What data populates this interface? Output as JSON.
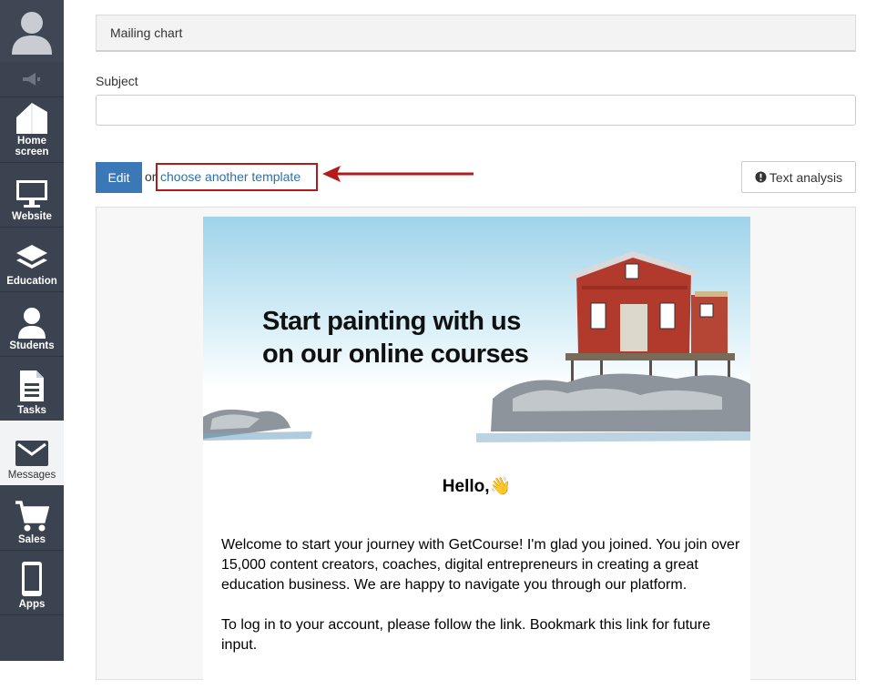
{
  "sidebar": {
    "items": [
      {
        "label_line1": "Home",
        "label_line2": "screen",
        "icon": "home-icon"
      },
      {
        "label_line1": "Website",
        "label_line2": "",
        "icon": "monitor-icon"
      },
      {
        "label_line1": "Education",
        "label_line2": "",
        "icon": "education-icon"
      },
      {
        "label_line1": "Students",
        "label_line2": "",
        "icon": "student-icon"
      },
      {
        "label_line1": "Tasks",
        "label_line2": "",
        "icon": "document-icon"
      },
      {
        "label_line1": "Messages",
        "label_line2": "",
        "icon": "envelope-icon"
      },
      {
        "label_line1": "Sales",
        "label_line2": "",
        "icon": "cart-icon"
      },
      {
        "label_line1": "Apps",
        "label_line2": "",
        "icon": "phone-icon"
      }
    ],
    "active": "Messages"
  },
  "main": {
    "mailing_chart": "Mailing chart",
    "subject_label": "Subject",
    "subject_value": "",
    "edit_label": "Edit",
    "or_text": "or",
    "template_link": "choose another template",
    "text_analysis_label": "Text analysis"
  },
  "email": {
    "hero_line1": "Start painting with us",
    "hero_line2": "on our online courses",
    "hello": "Hello,👋",
    "paragraph1": "Welcome to start your journey with GetCourse! I'm glad you joined. You join over 15,000 content creators, coaches, digital entrepreneurs in creating a great education business. We are happy to navigate you through our platform.",
    "paragraph2": "To log in to your account, please follow the link. Bookmark this link for future input."
  },
  "colors": {
    "sidebar": "#3b4350",
    "edit_button": "#3b78b8",
    "link": "#2f6fa7",
    "highlight": "#b41a1a"
  }
}
